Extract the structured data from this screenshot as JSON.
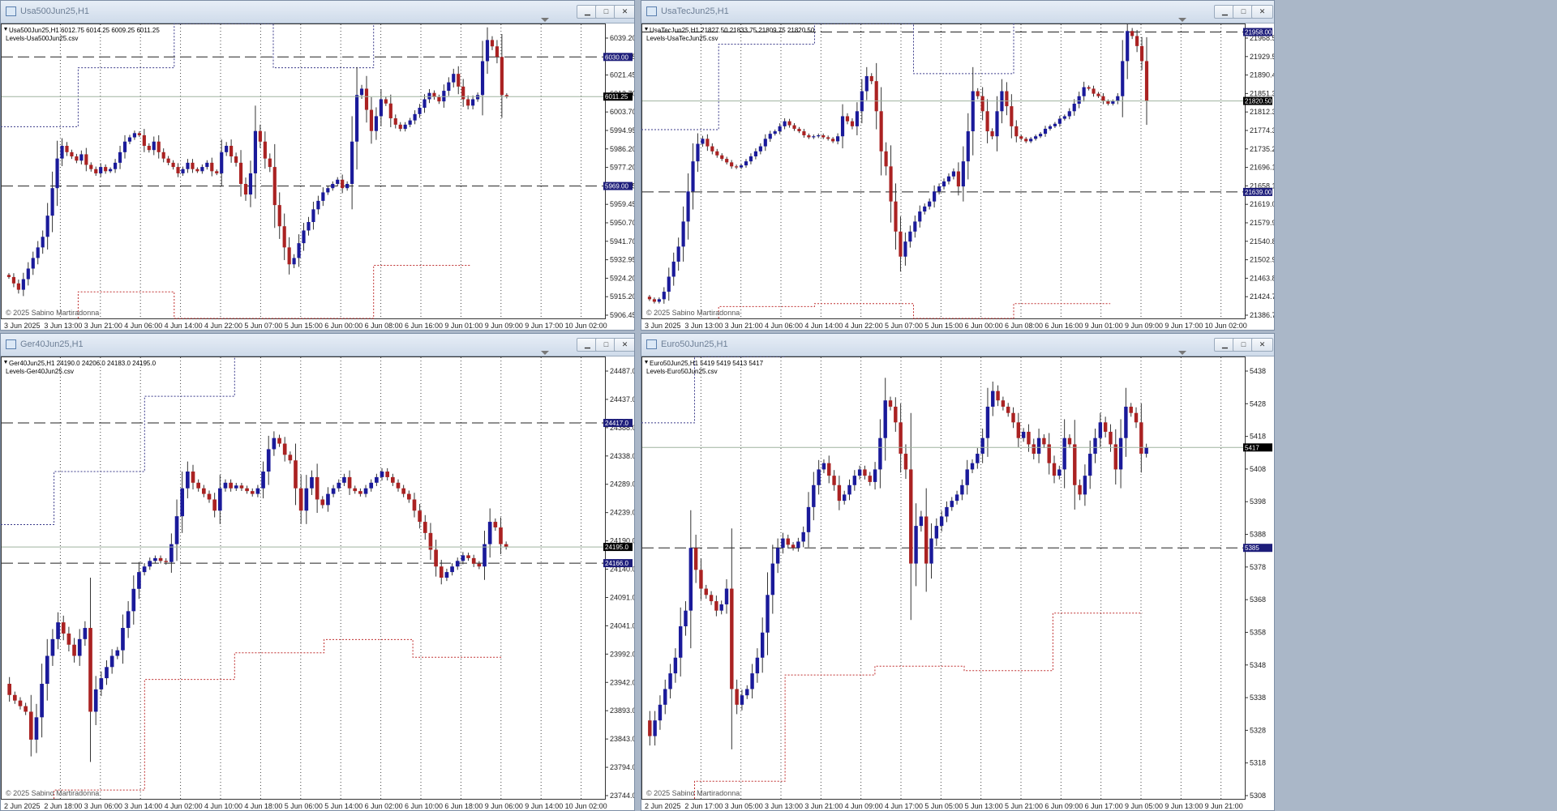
{
  "colors": {
    "bull": "#1a1a9a",
    "bear": "#aa2222",
    "upper_level": "#3a3a8a",
    "lower_level": "#c03030",
    "grid": "#444444",
    "price_line": "#9fb39f",
    "level_tag": "#1d1d7a",
    "last_tag": "#000000"
  },
  "charts": [
    {
      "title": "Usa500Jun25,H1",
      "header": "Usa500Jun25,H1  6012.75 6014.25 6009.25 6011.25",
      "subheader": "Levels-Usa500Jun25.csv",
      "copyright": "© 2025 Sabino Martiradonna",
      "last_price": "6011.25",
      "levels": [
        {
          "label": "6030.00",
          "value": 6030.0
        },
        {
          "label": "5969.00",
          "value": 5969.0
        }
      ],
      "chart_data": {
        "type": "candlestick",
        "ylim": [
          5906.45,
          6045.8
        ],
        "y_ticks": [
          "6039.20",
          "6030.45",
          "6021.45",
          "6012.70",
          "6003.70",
          "5994.95",
          "5986.20",
          "5977.20",
          "5968.45",
          "5959.45",
          "5950.70",
          "5941.70",
          "5932.95",
          "5924.20",
          "5915.20",
          "5906.45"
        ],
        "x_ticks": [
          "3 Jun 2025",
          "3 Jun 13:00",
          "3 Jun 21:00",
          "4 Jun 06:00",
          "4 Jun 14:00",
          "4 Jun 22:00",
          "5 Jun 07:00",
          "5 Jun 15:00",
          "6 Jun 00:00",
          "6 Jun 08:00",
          "6 Jun 16:00",
          "9 Jun 01:00",
          "9 Jun 09:00",
          "9 Jun 17:00",
          "10 Jun 02:00"
        ],
        "closes": [
          5927,
          5926,
          5923,
          5920,
          5925,
          5930,
          5935,
          5940,
          5945,
          5955,
          5968,
          5982,
          5988,
          5985,
          5983,
          5981,
          5984,
          5979,
          5977,
          5975,
          5978,
          5976,
          5977,
          5980,
          5985,
          5990,
          5992,
          5994,
          5993,
          5988,
          5986,
          5990,
          5985,
          5982,
          5980,
          5978,
          5975,
          5977,
          5980,
          5977,
          5976,
          5978,
          5980,
          5976,
          5975,
          5985,
          5988,
          5983,
          5980,
          5970,
          5965,
          5975,
          5995,
          5990,
          5982,
          5978,
          5960,
          5950,
          5940,
          5932,
          5935,
          5942,
          5948,
          5952,
          5958,
          5962,
          5966,
          5968,
          5970,
          5972,
          5968,
          5970,
          5990,
          6012,
          6015,
          6005,
          5995,
          6002,
          6010,
          6008,
          6001,
          5998,
          5996,
          5998,
          6000,
          6003,
          6006,
          6010,
          6013,
          6011,
          6009,
          6014,
          6018,
          6022,
          6016,
          6010,
          6007,
          6010,
          6012,
          6028,
          6038,
          6035,
          6030,
          6012,
          6011.25
        ]
      },
      "upper_path": [
        [
          0,
          0.35
        ],
        [
          0.128,
          0.35
        ],
        [
          0.128,
          0.15
        ],
        [
          0.287,
          0.15
        ],
        [
          0.287,
          0
        ],
        [
          0.451,
          0
        ],
        [
          0.451,
          0.15
        ],
        [
          0.617,
          0.15
        ],
        [
          0.617,
          0
        ]
      ],
      "lower_path": [
        [
          0.128,
          1
        ],
        [
          0.128,
          0.91
        ],
        [
          0.287,
          0.91
        ],
        [
          0.287,
          1
        ],
        [
          0.617,
          1
        ],
        [
          0.617,
          0.82
        ],
        [
          0.777,
          0.82
        ]
      ]
    },
    {
      "title": "UsaTecJun25,H1",
      "header": "UsaTecJun25,H1  21827.50 21833.75 21809.75 21820.50",
      "subheader": "Levels-UsaTecJun25.csv",
      "copyright": "© 2025 Sabino Martiradonna",
      "last_price": "21820.50",
      "levels": [
        {
          "label": "21958.00",
          "value": 21958.0
        },
        {
          "label": "21639.00",
          "value": 21639.0
        }
      ],
      "chart_data": {
        "type": "candlestick",
        "ylim": [
          21386.75,
          21975.0
        ],
        "y_ticks": [
          "21968.50",
          "21929.55",
          "21890.45",
          "21851.35",
          "21812.30",
          "21774.30",
          "21735.20",
          "21696.10",
          "21658.15",
          "21619.05",
          "21579.95",
          "21540.80",
          "21502.90",
          "21463.80",
          "21424.70",
          "21386.75"
        ],
        "x_ticks": [
          "3 Jun 2025",
          "3 Jun 13:00",
          "3 Jun 21:00",
          "4 Jun 06:00",
          "4 Jun 14:00",
          "4 Jun 22:00",
          "5 Jun 07:00",
          "5 Jun 15:00",
          "6 Jun 00:00",
          "6 Jun 08:00",
          "6 Jun 16:00",
          "9 Jun 01:00",
          "9 Jun 09:00",
          "9 Jun 17:00",
          "10 Jun 02:00"
        ],
        "closes": [
          21430,
          21425,
          21420,
          21425,
          21440,
          21470,
          21500,
          21530,
          21580,
          21640,
          21700,
          21735,
          21745,
          21730,
          21720,
          21712,
          21705,
          21698,
          21690,
          21688,
          21692,
          21700,
          21710,
          21720,
          21730,
          21745,
          21755,
          21760,
          21770,
          21780,
          21772,
          21765,
          21760,
          21752,
          21748,
          21750,
          21752,
          21748,
          21745,
          21740,
          21750,
          21790,
          21780,
          21770,
          21800,
          21840,
          21870,
          21860,
          21800,
          21720,
          21690,
          21620,
          21560,
          21510,
          21540,
          21560,
          21580,
          21600,
          21610,
          21620,
          21640,
          21650,
          21660,
          21670,
          21680,
          21650,
          21700,
          21760,
          21840,
          21830,
          21800,
          21760,
          21750,
          21800,
          21840,
          21810,
          21770,
          21750,
          21745,
          21740,
          21745,
          21750,
          21755,
          21765,
          21770,
          21775,
          21785,
          21790,
          21800,
          21815,
          21830,
          21848,
          21845,
          21835,
          21830,
          21820,
          21815,
          21820,
          21830,
          21900,
          21960,
          21950,
          21930,
          21900,
          21820.5
        ]
      },
      "upper_path": [
        [
          0,
          0.36
        ],
        [
          0.128,
          0.36
        ],
        [
          0.128,
          0.07
        ],
        [
          0.287,
          0.07
        ],
        [
          0.287,
          0
        ],
        [
          0.451,
          0
        ],
        [
          0.451,
          0.17
        ],
        [
          0.617,
          0.17
        ],
        [
          0.617,
          0
        ]
      ],
      "lower_path": [
        [
          0.128,
          1
        ],
        [
          0.128,
          0.96
        ],
        [
          0.287,
          0.96
        ],
        [
          0.287,
          0.95
        ],
        [
          0.451,
          0.95
        ],
        [
          0.451,
          1
        ],
        [
          0.617,
          1
        ],
        [
          0.617,
          0.95
        ],
        [
          0.777,
          0.95
        ]
      ]
    },
    {
      "title": "Ger40Jun25,H1",
      "header": "Ger40Jun25,H1  24190.0 24206.0 24183.0 24195.0",
      "subheader": "Levels-Ger40Jun25.csv",
      "copyright": "© 2025 Sabino Martiradonna",
      "last_price": "24195.0",
      "levels": [
        {
          "label": "24417.0",
          "value": 24417.0
        },
        {
          "label": "24166.0",
          "value": 24166.0
        }
      ],
      "chart_data": {
        "type": "candlestick",
        "ylim": [
          23744.0,
          24536.0
        ],
        "y_ticks": [
          "24487.0",
          "24437.0",
          "24388.0",
          "24338.0",
          "24289.0",
          "24239.0",
          "24190.0",
          "24140.0",
          "24091.0",
          "24041.0",
          "23992.0",
          "23942.0",
          "23893.0",
          "23843.0",
          "23794.0",
          "23744.0"
        ],
        "x_ticks": [
          "2 Jun 2025",
          "2 Jun 18:00",
          "3 Jun 06:00",
          "3 Jun 14:00",
          "4 Jun 02:00",
          "4 Jun 10:00",
          "4 Jun 18:00",
          "5 Jun 06:00",
          "5 Jun 14:00",
          "6 Jun 02:00",
          "6 Jun 10:00",
          "6 Jun 18:00",
          "9 Jun 06:00",
          "9 Jun 14:00",
          "10 Jun 02:00"
        ],
        "closes": [
          23950,
          23930,
          23920,
          23910,
          23900,
          23850,
          23890,
          23950,
          24000,
          24030,
          24060,
          24040,
          24020,
          24000,
          24030,
          24050,
          23900,
          23940,
          23960,
          23980,
          24000,
          24010,
          24050,
          24080,
          24120,
          24150,
          24160,
          24170,
          24175,
          24170,
          24168,
          24200,
          24250,
          24300,
          24330,
          24310,
          24300,
          24290,
          24280,
          24260,
          24300,
          24310,
          24300,
          24305,
          24300,
          24295,
          24290,
          24300,
          24330,
          24370,
          24390,
          24380,
          24360,
          24350,
          24300,
          24260,
          24300,
          24320,
          24280,
          24270,
          24290,
          24300,
          24310,
          24320,
          24300,
          24295,
          24290,
          24300,
          24310,
          24320,
          24330,
          24320,
          24310,
          24300,
          24290,
          24280,
          24260,
          24240,
          24220,
          24190,
          24160,
          24140,
          24150,
          24160,
          24170,
          24180,
          24175,
          24165,
          24160,
          24200,
          24240,
          24230,
          24200,
          24195
        ]
      },
      "upper_path": [
        [
          0,
          0.38
        ],
        [
          0.088,
          0.38
        ],
        [
          0.088,
          0.26
        ],
        [
          0.238,
          0.26
        ],
        [
          0.238,
          0.09
        ],
        [
          0.387,
          0.09
        ],
        [
          0.387,
          0
        ]
      ],
      "lower_path": [
        [
          0.088,
          1
        ],
        [
          0.088,
          0.98
        ],
        [
          0.238,
          0.98
        ],
        [
          0.238,
          0.73
        ],
        [
          0.387,
          0.73
        ],
        [
          0.387,
          0.67
        ],
        [
          0.535,
          0.67
        ],
        [
          0.535,
          0.64
        ],
        [
          0.682,
          0.64
        ],
        [
          0.682,
          0.68
        ],
        [
          0.83,
          0.68
        ]
      ]
    },
    {
      "title": "Euro50Jun25,H1",
      "header": "Euro50Jun25,H1  5419 5419 5413 5417",
      "subheader": "Levels-Euro50Jun25.csv",
      "copyright": "© 2025 Sabino Martiradonna",
      "last_price": "5417",
      "levels": [
        {
          "label": "5385",
          "value": 5385
        }
      ],
      "chart_data": {
        "type": "candlestick",
        "ylim": [
          5305,
          5446
        ],
        "y_ticks": [
          "5438",
          "5428",
          "5418",
          "5408",
          "5398",
          "5388",
          "5378",
          "5368",
          "5358",
          "5348",
          "5338",
          "5328",
          "5318",
          "5308"
        ],
        "x_ticks": [
          "2 Jun 2025",
          "2 Jun 17:00",
          "3 Jun 05:00",
          "3 Jun 13:00",
          "3 Jun 21:00",
          "4 Jun 09:00",
          "4 Jun 17:00",
          "5 Jun 05:00",
          "5 Jun 13:00",
          "5 Jun 21:00",
          "6 Jun 09:00",
          "6 Jun 17:00",
          "9 Jun 05:00",
          "9 Jun 13:00",
          "9 Jun 21:00"
        ],
        "closes": [
          5330,
          5325,
          5330,
          5335,
          5340,
          5345,
          5350,
          5360,
          5365,
          5385,
          5378,
          5372,
          5370,
          5368,
          5365,
          5367,
          5372,
          5340,
          5335,
          5338,
          5340,
          5345,
          5350,
          5358,
          5370,
          5380,
          5385,
          5388,
          5386,
          5385,
          5387,
          5390,
          5398,
          5405,
          5410,
          5412,
          5408,
          5405,
          5400,
          5402,
          5405,
          5408,
          5410,
          5408,
          5406,
          5410,
          5420,
          5432,
          5430,
          5425,
          5415,
          5410,
          5380,
          5392,
          5395,
          5380,
          5388,
          5392,
          5395,
          5398,
          5400,
          5402,
          5405,
          5410,
          5412,
          5415,
          5420,
          5430,
          5435,
          5432,
          5430,
          5428,
          5425,
          5420,
          5422,
          5418,
          5415,
          5420,
          5418,
          5412,
          5408,
          5410,
          5420,
          5418,
          5405,
          5402,
          5408,
          5415,
          5420,
          5425,
          5422,
          5418,
          5410,
          5420,
          5430,
          5428,
          5425,
          5415,
          5417
        ]
      },
      "upper_path": [
        [
          0,
          0.15
        ],
        [
          0.088,
          0.15
        ],
        [
          0.088,
          0
        ],
        [
          0.238,
          0
        ]
      ],
      "lower_path": [
        [
          0.088,
          1
        ],
        [
          0.088,
          0.96
        ],
        [
          0.238,
          0.96
        ],
        [
          0.238,
          0.72
        ],
        [
          0.387,
          0.72
        ],
        [
          0.387,
          0.7
        ],
        [
          0.535,
          0.7
        ],
        [
          0.535,
          0.71
        ],
        [
          0.682,
          0.71
        ],
        [
          0.682,
          0.58
        ],
        [
          0.83,
          0.58
        ]
      ]
    }
  ]
}
